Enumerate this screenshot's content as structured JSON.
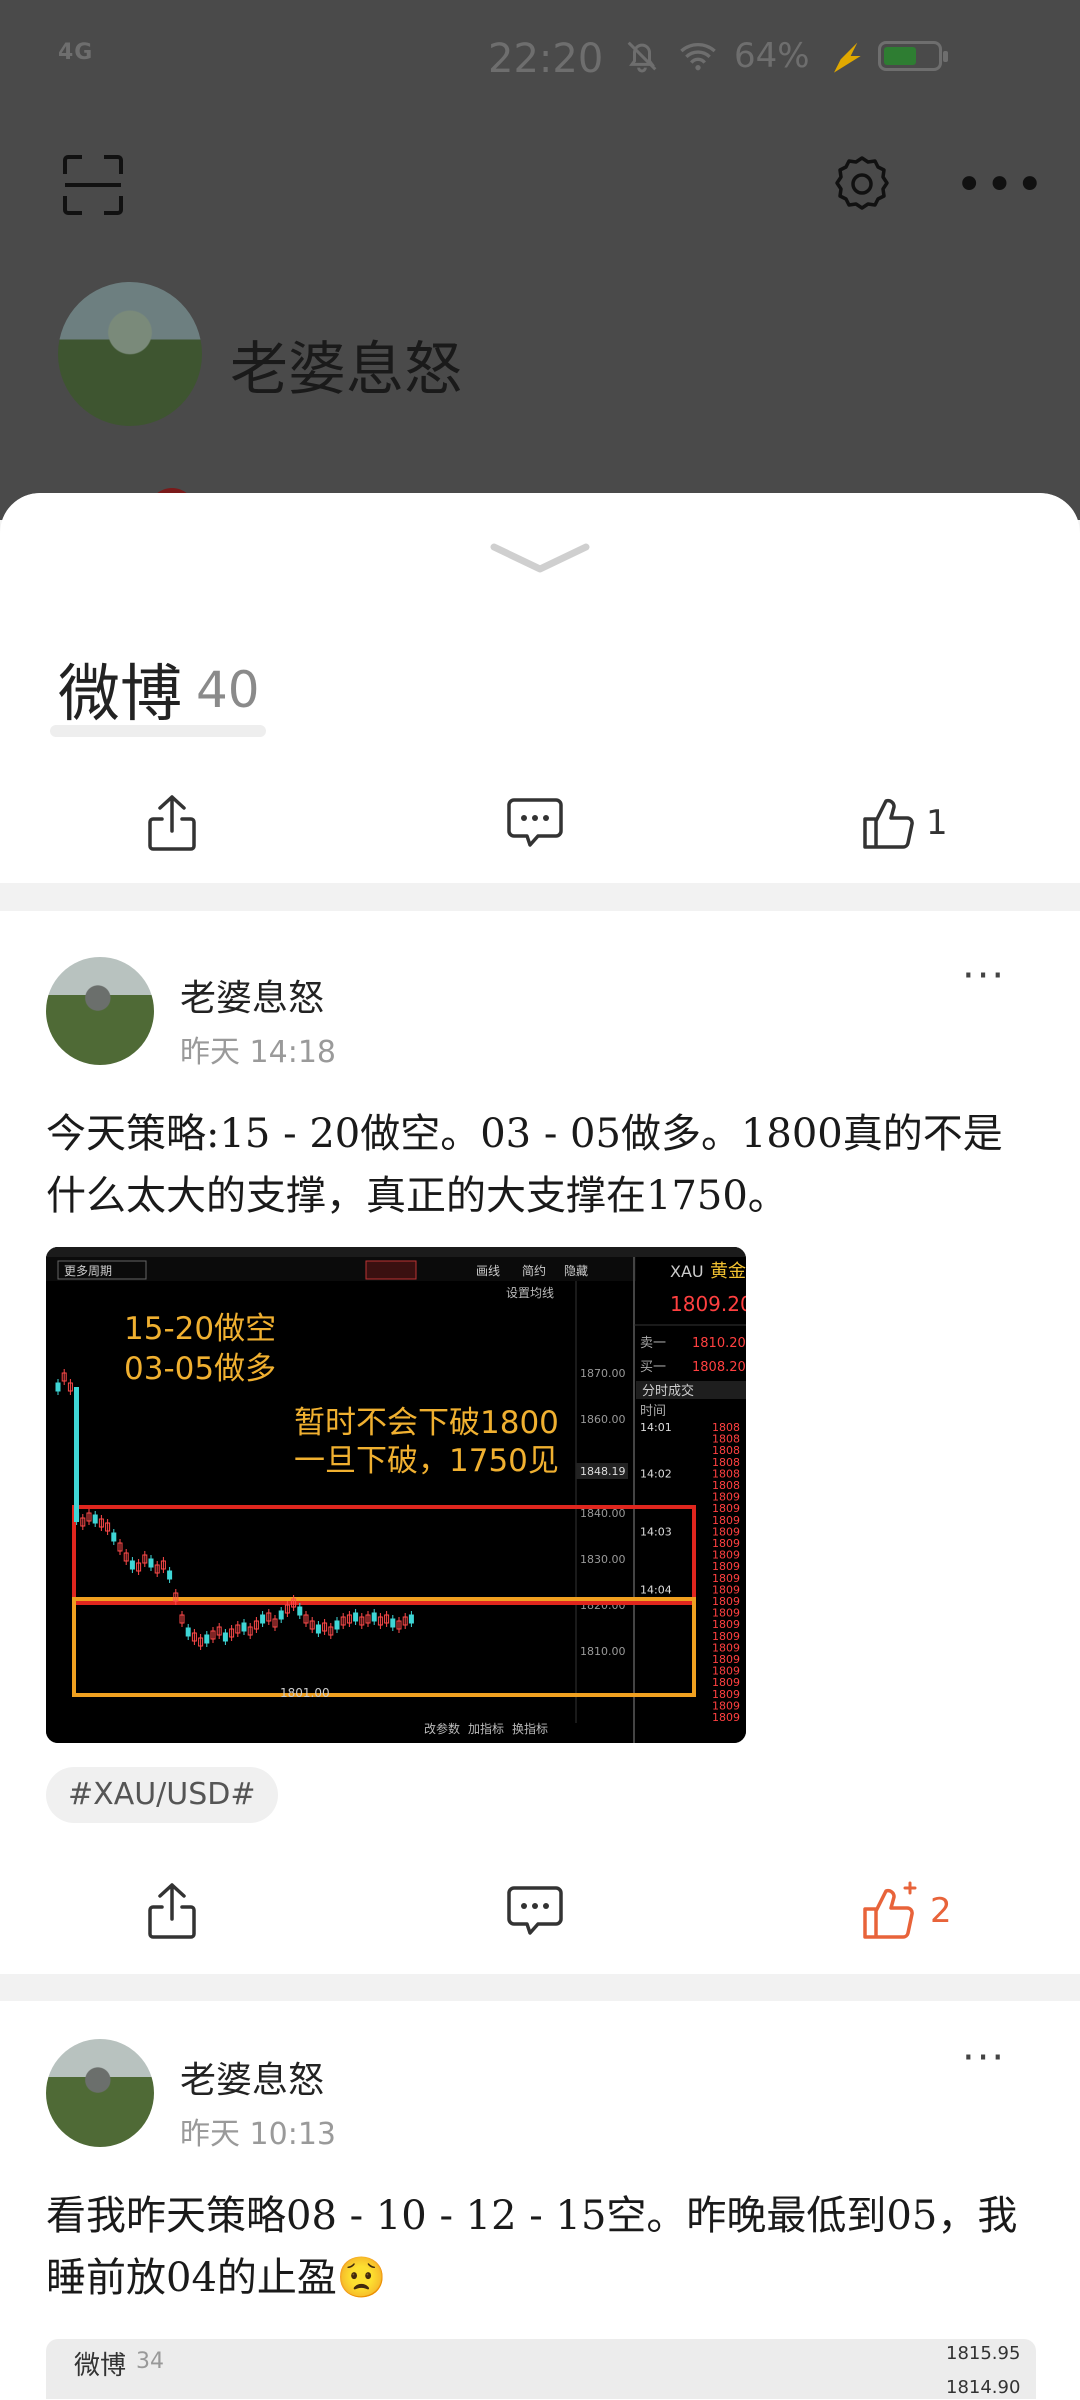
{
  "status_bar": {
    "signal": "4G",
    "time": "22:20",
    "battery_percent": "64%"
  },
  "profile": {
    "name": "老婆息怒"
  },
  "tab": {
    "title": "微博",
    "count": "40"
  },
  "top_actions": {
    "like_count": "1"
  },
  "posts": [
    {
      "author": "老婆息怒",
      "time": "昨天 14:18",
      "text": "今天策略:15 - 20做空。03 - 05做多。1800真的不是什么太大的支撑，真正的大支撑在1750。",
      "hashtag": "#XAU/USD#",
      "like_count": "2",
      "chart": {
        "symbol": "XAU",
        "name": "黄金",
        "price": "1809.20",
        "sell_label": "卖一",
        "sell_price": "1810.20",
        "buy_label": "买一",
        "buy_price": "1808.20",
        "trades_label": "分时成交",
        "time_col": "时间",
        "note1": "15-20做空",
        "note2": "03-05做多",
        "note3": "暂时不会下破1800",
        "note4": "一旦下破，1750见",
        "menu_periods": "更多周期",
        "setting": "设置均线",
        "low_label": "1801.00",
        "current_tag": "1848.19",
        "y_ticks": [
          "1870.00",
          "1860.00",
          "1840.00",
          "1830.00",
          "1820.00",
          "1810.00"
        ],
        "times": [
          "14:01",
          "14:02",
          "14:03",
          "14:04"
        ],
        "bottom_btns": [
          "改参数",
          "加指标",
          "换指标"
        ],
        "toolbar": [
          "画线",
          "简约",
          "隐藏"
        ]
      }
    },
    {
      "author": "老婆息怒",
      "time": "昨天 10:13",
      "text": "看我昨天策略08 - 10 - 12 - 15空。昨晚最低到05，我睡前放04的止盈😟",
      "thumb": {
        "title": "微博",
        "count": "34",
        "r1": "1815.95",
        "r2": "1814.90"
      }
    }
  ]
}
